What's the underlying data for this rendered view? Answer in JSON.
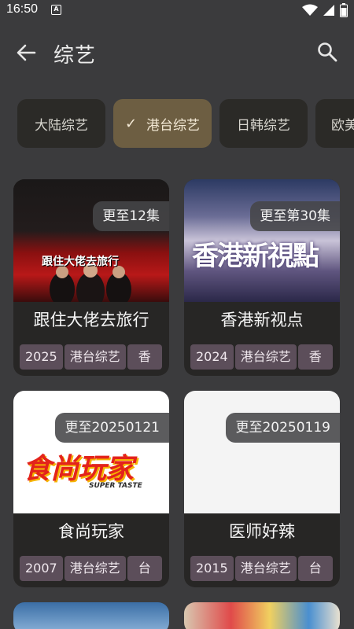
{
  "status": {
    "time": "16:50",
    "notification_letter": "A"
  },
  "header": {
    "title": "综艺"
  },
  "icons": {
    "back": "arrow-left-icon",
    "search": "search-icon",
    "check": "check-icon"
  },
  "chips": [
    {
      "label": "大陆综艺",
      "selected": false
    },
    {
      "label": "港台综艺",
      "selected": true
    },
    {
      "label": "日韩综艺",
      "selected": false
    },
    {
      "label": "欧美",
      "selected": false
    }
  ],
  "cards": [
    {
      "title": "跟住大佬去旅行",
      "badge": "更至12集",
      "year": "2025",
      "category": "港台综艺",
      "region": "香",
      "poster_text": "跟住大佬去旅行"
    },
    {
      "title": "香港新视点",
      "badge": "更至第30集",
      "year": "2024",
      "category": "港台综艺",
      "region": "香",
      "poster_text": "香港新視點"
    },
    {
      "title": "食尚玩家",
      "badge": "更至20250121",
      "year": "2007",
      "category": "港台综艺",
      "region": "台",
      "poster_text": "食尚玩家",
      "poster_subtext": "SUPER TASTE"
    },
    {
      "title": "医师好辣",
      "badge": "更至20250119",
      "year": "2015",
      "category": "港台综艺",
      "region": "台"
    }
  ],
  "colors": {
    "background": "#3b3b3d",
    "chip": "#2b2a27",
    "chip_selected": "#6d5e42",
    "tag": "#5c4e5a",
    "card": "#272625"
  }
}
